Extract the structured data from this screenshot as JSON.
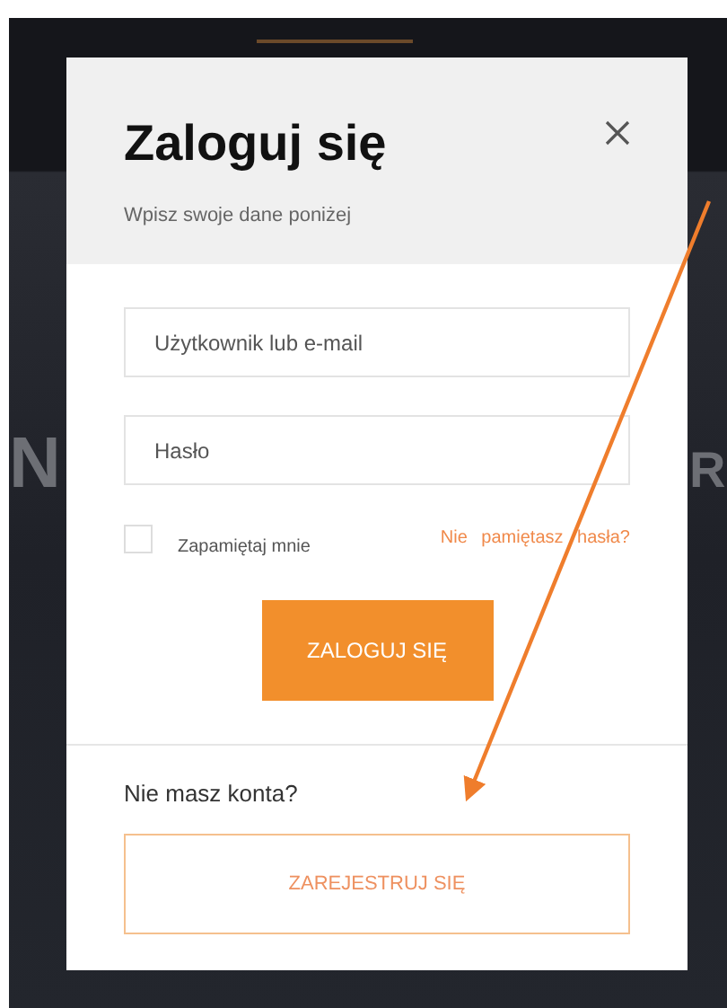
{
  "background_text": [
    "N",
    "R"
  ],
  "header": {
    "title": "Zaloguj się",
    "subtitle": "Wpisz swoje dane poniżej"
  },
  "fields": [
    {
      "placeholder": "Użytkownik lub e-mail"
    },
    {
      "placeholder": "Hasło"
    }
  ],
  "remember": {
    "label": "Zapamiętaj mnie",
    "checked": false
  },
  "forgot_link": "Nie pamiętasz hasła?",
  "login_button": "ZALOGUJ SIĘ",
  "register_prompt": "Nie masz konta?",
  "register_button": "ZAREJESTRUJ SIĘ"
}
